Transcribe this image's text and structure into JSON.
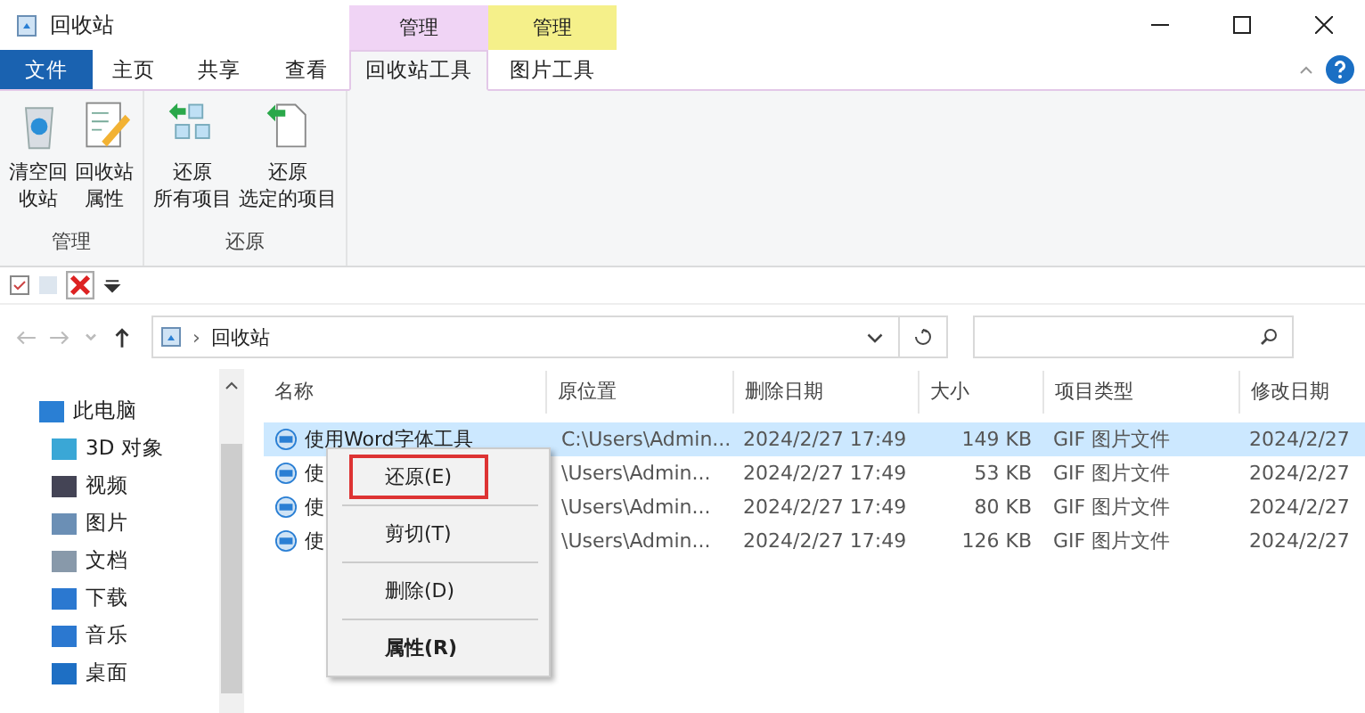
{
  "window": {
    "title": "回收站"
  },
  "context_tabs": [
    {
      "label": "管理",
      "color": "#f0d4f5"
    },
    {
      "label": "管理",
      "color": "#f5f08a"
    }
  ],
  "tabs": [
    {
      "label": "文件",
      "kind": "file",
      "selected": false
    },
    {
      "label": "主页",
      "kind": "tab",
      "selected": false
    },
    {
      "label": "共享",
      "kind": "tab",
      "selected": false
    },
    {
      "label": "查看",
      "kind": "tab",
      "selected": false
    },
    {
      "label": "回收站工具",
      "kind": "tab",
      "selected": true
    },
    {
      "label": "图片工具",
      "kind": "tab",
      "selected": false
    }
  ],
  "ribbon_groups": [
    {
      "label": "管理",
      "buttons": [
        {
          "lines": [
            "清空回",
            "收站"
          ]
        },
        {
          "lines": [
            "回收站",
            "属性"
          ]
        }
      ]
    },
    {
      "label": "还原",
      "buttons": [
        {
          "lines": [
            "还原",
            "所有项目"
          ]
        },
        {
          "lines": [
            "还原",
            "选定的项目"
          ]
        }
      ]
    }
  ],
  "address": {
    "separator": "›",
    "path": "回收站"
  },
  "sidebar": {
    "items": [
      {
        "label": "此电脑",
        "children": [
          {
            "label": "3D 对象"
          },
          {
            "label": "视频"
          },
          {
            "label": "图片"
          },
          {
            "label": "文档"
          },
          {
            "label": "下载"
          },
          {
            "label": "音乐"
          },
          {
            "label": "桌面"
          }
        ]
      }
    ]
  },
  "table": {
    "columns": [
      "名称",
      "原位置",
      "删除日期",
      "大小",
      "项目类型",
      "修改日期"
    ],
    "rows": [
      {
        "cells": [
          "使用Word字体工具",
          "C:\\Users\\Admin...",
          "2024/2/27 17:49",
          "149 KB",
          "GIF 图片文件",
          "2024/2/27"
        ],
        "selected": true
      },
      {
        "cells": [
          "使",
          "\\Users\\Admin...",
          "2024/2/27 17:49",
          "53 KB",
          "GIF 图片文件",
          "2024/2/27"
        ],
        "selected": false
      },
      {
        "cells": [
          "使",
          "\\Users\\Admin...",
          "2024/2/27 17:49",
          "80 KB",
          "GIF 图片文件",
          "2024/2/27"
        ],
        "selected": false
      },
      {
        "cells": [
          "使",
          "\\Users\\Admin...",
          "2024/2/27 17:49",
          "126 KB",
          "GIF 图片文件",
          "2024/2/27"
        ],
        "selected": false
      }
    ]
  },
  "context_menu": [
    {
      "label": "还原(E)",
      "selected": true,
      "bold": false
    },
    {
      "label": "剪切(T)",
      "selected": false,
      "bold": false
    },
    {
      "label": "删除(D)",
      "selected": false,
      "bold": false
    },
    {
      "label": "属性(R)",
      "selected": false,
      "bold": true
    }
  ]
}
